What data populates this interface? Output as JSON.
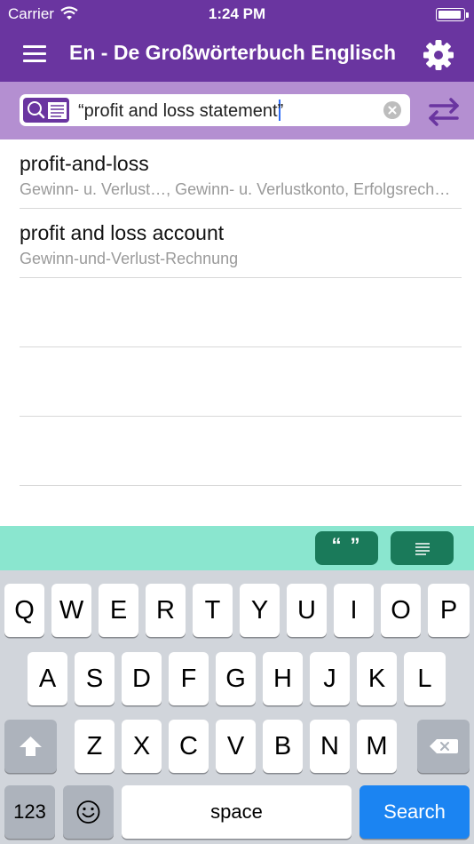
{
  "status_bar": {
    "carrier": "Carrier",
    "time": "1:24 PM",
    "battery_level": 0.95
  },
  "nav_bar": {
    "title": "En - De Großwörterbuch Englisch",
    "menu_icon": "hamburger-menu-icon",
    "settings_icon": "gear-icon"
  },
  "search": {
    "query": "“profit and loss statement",
    "query_after_caret": "”",
    "mode_icon": "search-text-mode-icon",
    "clear_icon": "clear-circle-icon",
    "swap_icon": "swap-direction-icon"
  },
  "results": [
    {
      "title": "profit-and-loss",
      "subtitle": "Gewinn- u. Verlust…, Gewinn- u. Verlustkonto, Erfolgsrechnung"
    },
    {
      "title": "profit and loss account",
      "subtitle": "Gewinn-und-Verlust-Rechnung"
    }
  ],
  "mode_toolbar": {
    "quote_label": "“ ”",
    "text_icon": "text-lines-icon"
  },
  "keyboard": {
    "row1": [
      "Q",
      "W",
      "E",
      "R",
      "T",
      "Y",
      "U",
      "I",
      "O",
      "P"
    ],
    "row2": [
      "A",
      "S",
      "D",
      "F",
      "G",
      "H",
      "J",
      "K",
      "L"
    ],
    "row3": [
      "Z",
      "X",
      "C",
      "V",
      "B",
      "N",
      "M"
    ],
    "numbers_label": "123",
    "space_label": "space",
    "search_label": "Search",
    "shift_icon": "shift-arrow-icon",
    "backspace_icon": "backspace-icon",
    "emoji_icon": "emoji-icon"
  },
  "colors": {
    "brand_purple": "#6a35a0",
    "search_bar_lavender": "#b48fd1",
    "toolbar_mint": "#8ae6cf",
    "toolbar_button_green": "#1a7a5a",
    "keyboard_search_blue": "#1b84f2"
  }
}
